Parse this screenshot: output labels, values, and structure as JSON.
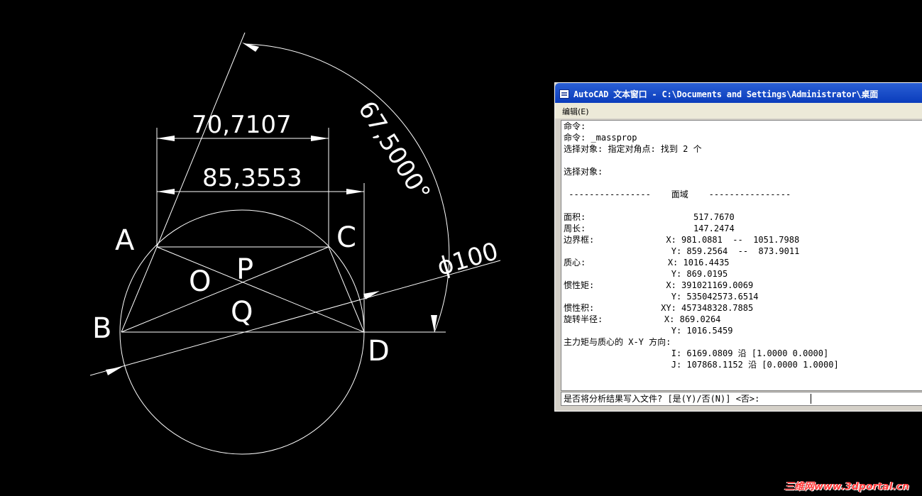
{
  "drawing": {
    "point_labels": {
      "A": "A",
      "B": "B",
      "C": "C",
      "D": "D",
      "O": "O",
      "P": "P",
      "Q": "Q"
    },
    "dimensions": {
      "top_linear": "70,7107",
      "second_linear": "85,3553",
      "angular": "67,5000°",
      "diameter": "ϕ100"
    }
  },
  "text_window": {
    "title": "AutoCAD 文本窗口 - C:\\Documents and Settings\\Administrator\\桌面",
    "menu_edit": "编辑(E)",
    "lines": [
      "命令:",
      "命令: _massprop",
      "选择对象: 指定对角点: 找到 2 个",
      "",
      "选择对象:",
      "",
      " ----------------    面域    ----------------",
      "",
      "面积:                     517.7670",
      "周长:                     147.2474",
      "边界框:              X: 981.0881  --  1051.7988",
      "                     Y: 859.2564  --  873.9011",
      "质心:                X: 1016.4435",
      "                     Y: 869.0195",
      "惯性矩:              X: 391021169.0069",
      "                     Y: 535042573.6514",
      "惯性积:             XY: 457348328.7885",
      "旋转半径:            X: 869.0264",
      "                     Y: 1016.5459",
      "主力矩与质心的 X-Y 方向:",
      "                     I: 6169.0809 沿 [1.0000 0.0000]",
      "                     J: 107868.1152 沿 [0.0000 1.0000]"
    ],
    "prompt": "是否将分析结果写入文件? [是(Y)/否(N)] <否>: "
  },
  "watermark": "三维网www.3dportal.cn",
  "colors": {
    "background": "#000000",
    "lines": "#ffffff",
    "titlebar": "#0a3cbc",
    "watermark": "#ff3b3b"
  }
}
